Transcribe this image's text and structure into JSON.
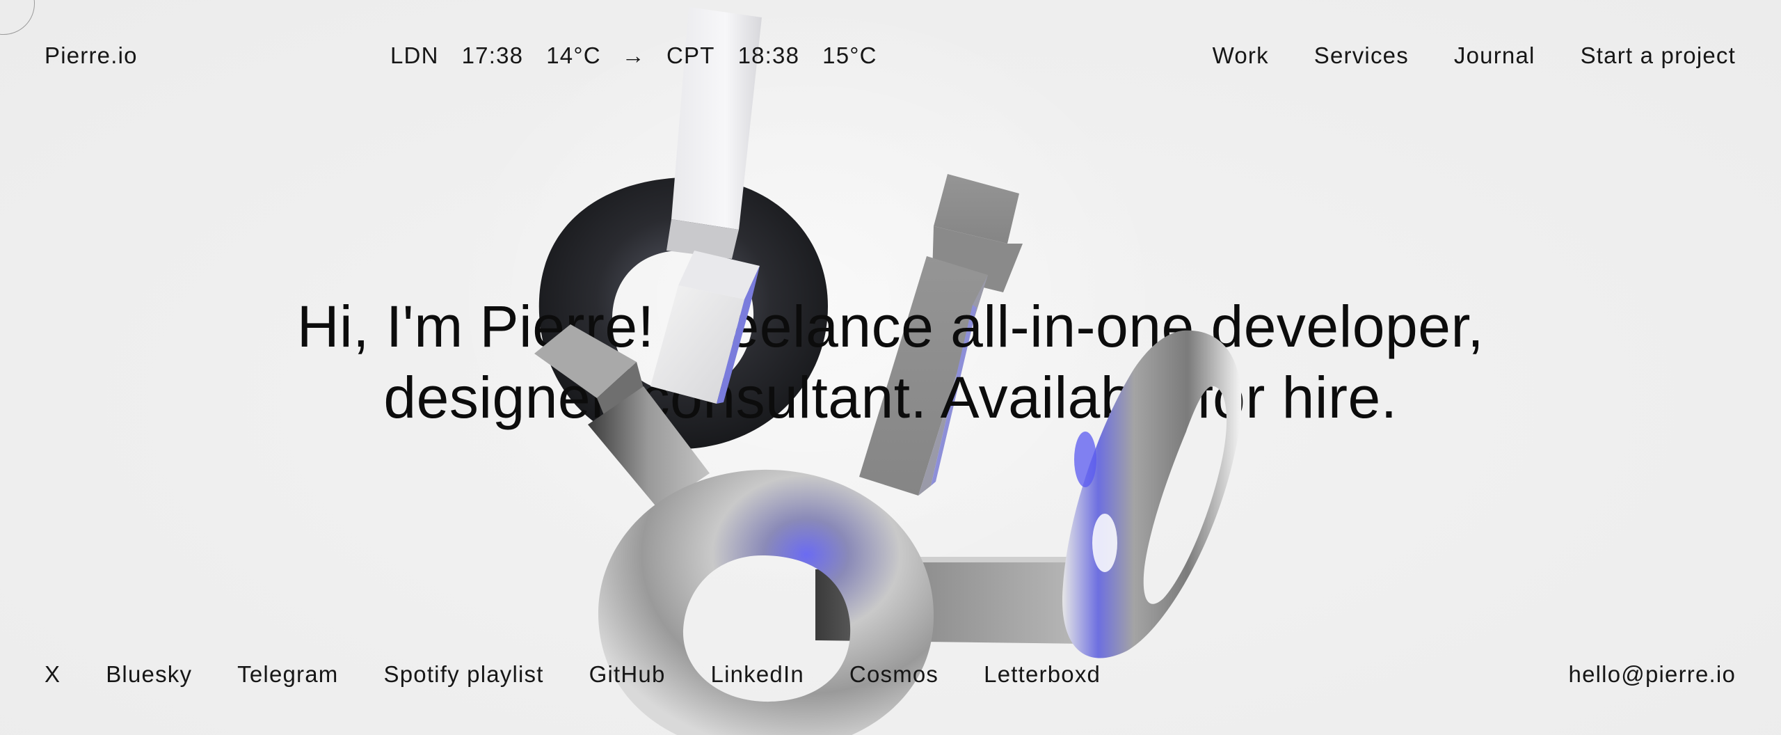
{
  "header": {
    "logo": "Pierre.io",
    "clock": {
      "city_a": "LDN",
      "time_a": "17:38",
      "temp_a": "14°C",
      "arrow": "→",
      "city_b": "CPT",
      "time_b": "18:38",
      "temp_b": "15°C"
    },
    "nav": [
      "Work",
      "Services",
      "Journal",
      "Start a project"
    ]
  },
  "hero": {
    "line1": "Hi, I'm Pierre! Freelance all-in-one developer,",
    "line2": "designer, consultant. Available for hire."
  },
  "footer": {
    "links": [
      "X",
      "Bluesky",
      "Telegram",
      "Spotify playlist",
      "GitHub",
      "LinkedIn",
      "Cosmos",
      "Letterboxd"
    ],
    "email": "hello@pierre.io"
  },
  "colors": {
    "background": "#efefef",
    "text": "#161616",
    "accent_glow": "#5a5af0"
  }
}
